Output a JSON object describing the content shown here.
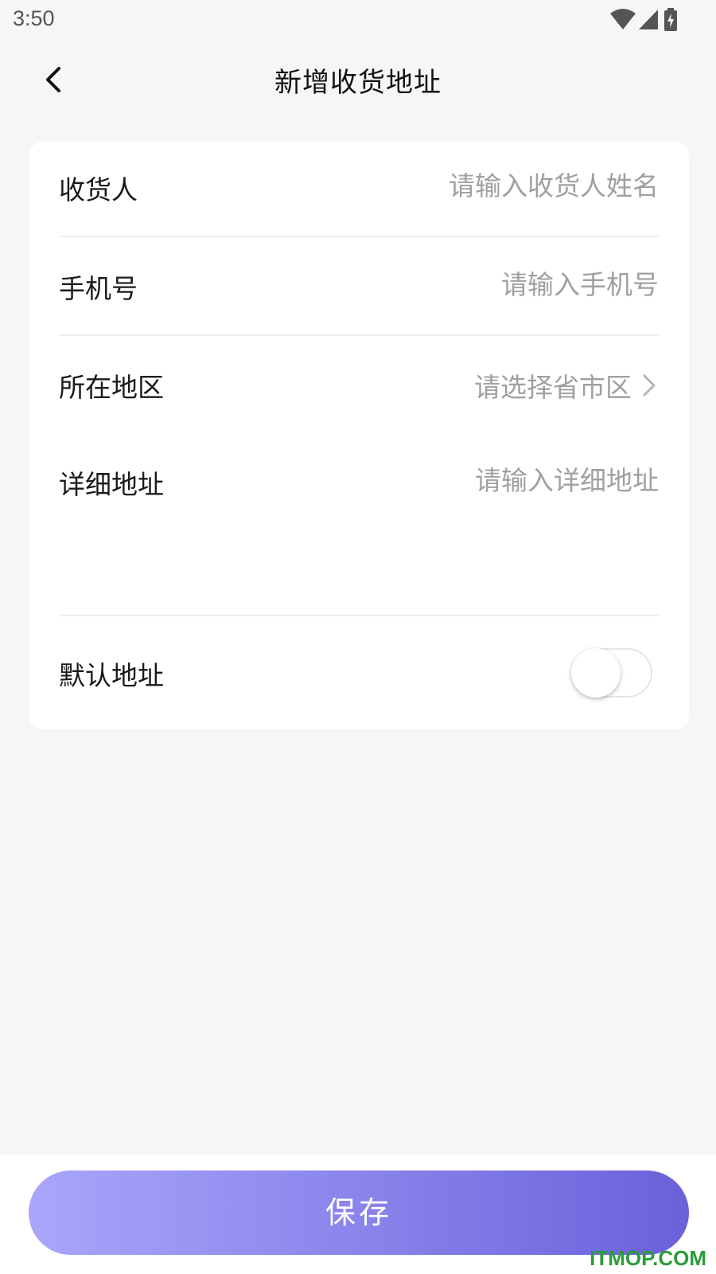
{
  "status_bar": {
    "time": "3:50",
    "icons": [
      "wifi-icon",
      "signal-icon",
      "battery-charging-icon"
    ]
  },
  "header": {
    "back_icon": "chevron-left-icon",
    "title": "新增收货地址"
  },
  "form": {
    "receiver": {
      "label": "收货人",
      "placeholder": "请输入收货人姓名",
      "value": ""
    },
    "phone": {
      "label": "手机号",
      "placeholder": "请输入手机号",
      "value": ""
    },
    "region": {
      "label": "所在地区",
      "placeholder": "请选择省市区",
      "icon": "chevron-right-icon"
    },
    "detail": {
      "label": "详细地址",
      "placeholder": "请输入详细地址",
      "value": ""
    },
    "default_address": {
      "label": "默认地址",
      "enabled": false
    }
  },
  "actions": {
    "save_label": "保存"
  },
  "watermark": "ITMOP.COM",
  "colors": {
    "accent_start": "#a9a6fb",
    "accent_end": "#6a61da",
    "background": "#f6f6f6"
  }
}
